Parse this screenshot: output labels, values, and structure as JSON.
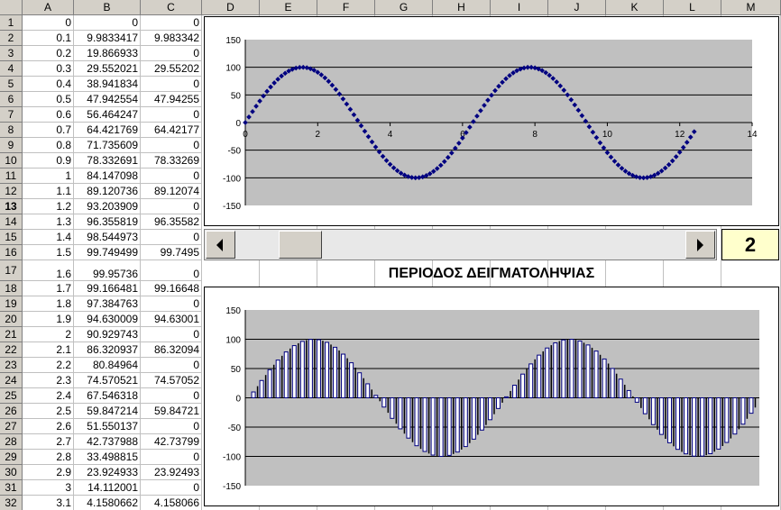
{
  "columns": [
    "A",
    "B",
    "C",
    "D",
    "E",
    "F",
    "G",
    "H",
    "I",
    "J",
    "K",
    "L",
    "M"
  ],
  "rows": [
    {
      "n": "1",
      "a": "0",
      "b": "0",
      "c": "0"
    },
    {
      "n": "2",
      "a": "0.1",
      "b": "9.9833417",
      "c": "9.983342"
    },
    {
      "n": "3",
      "a": "0.2",
      "b": "19.866933",
      "c": "0"
    },
    {
      "n": "4",
      "a": "0.3",
      "b": "29.552021",
      "c": "29.55202"
    },
    {
      "n": "5",
      "a": "0.4",
      "b": "38.941834",
      "c": "0"
    },
    {
      "n": "6",
      "a": "0.5",
      "b": "47.942554",
      "c": "47.94255"
    },
    {
      "n": "7",
      "a": "0.6",
      "b": "56.464247",
      "c": "0"
    },
    {
      "n": "8",
      "a": "0.7",
      "b": "64.421769",
      "c": "64.42177"
    },
    {
      "n": "9",
      "a": "0.8",
      "b": "71.735609",
      "c": "0"
    },
    {
      "n": "10",
      "a": "0.9",
      "b": "78.332691",
      "c": "78.33269"
    },
    {
      "n": "11",
      "a": "1",
      "b": "84.147098",
      "c": "0"
    },
    {
      "n": "12",
      "a": "1.1",
      "b": "89.120736",
      "c": "89.12074"
    },
    {
      "n": "13",
      "a": "1.2",
      "b": "93.203909",
      "c": "0"
    },
    {
      "n": "14",
      "a": "1.3",
      "b": "96.355819",
      "c": "96.35582"
    },
    {
      "n": "15",
      "a": "1.4",
      "b": "98.544973",
      "c": "0"
    },
    {
      "n": "16",
      "a": "1.5",
      "b": "99.749499",
      "c": "99.7495"
    },
    {
      "n": "17",
      "a": "1.6",
      "b": "99.95736",
      "c": "0"
    },
    {
      "n": "18",
      "a": "1.7",
      "b": "99.166481",
      "c": "99.16648"
    },
    {
      "n": "19",
      "a": "1.8",
      "b": "97.384763",
      "c": "0"
    },
    {
      "n": "20",
      "a": "1.9",
      "b": "94.630009",
      "c": "94.63001"
    },
    {
      "n": "21",
      "a": "2",
      "b": "90.929743",
      "c": "0"
    },
    {
      "n": "22",
      "a": "2.1",
      "b": "86.320937",
      "c": "86.32094"
    },
    {
      "n": "23",
      "a": "2.2",
      "b": "80.84964",
      "c": "0"
    },
    {
      "n": "24",
      "a": "2.3",
      "b": "74.570521",
      "c": "74.57052"
    },
    {
      "n": "25",
      "a": "2.4",
      "b": "67.546318",
      "c": "0"
    },
    {
      "n": "26",
      "a": "2.5",
      "b": "59.847214",
      "c": "59.84721"
    },
    {
      "n": "27",
      "a": "2.6",
      "b": "51.550137",
      "c": "0"
    },
    {
      "n": "28",
      "a": "2.7",
      "b": "42.737988",
      "c": "42.73799"
    },
    {
      "n": "29",
      "a": "2.8",
      "b": "33.498815",
      "c": "0"
    },
    {
      "n": "30",
      "a": "2.9",
      "b": "23.924933",
      "c": "23.92493"
    },
    {
      "n": "31",
      "a": "3",
      "b": "14.112001",
      "c": "0"
    },
    {
      "n": "32",
      "a": "3.1",
      "b": "4.1580662",
      "c": "4.158066"
    }
  ],
  "selected_row": "13",
  "scroll_value": "2",
  "sampling_title": "ΠΕΡΙΟΔΟΣ ΔΕΙΓΜΑΤΟΛΗΨΙΑΣ",
  "colors": {
    "plot_bg": "#c0c0c0",
    "marker": "#000080",
    "bar_fill": "#000080",
    "header_bg": "#d4d0c8",
    "value_box": "#ffffcc"
  },
  "chart_data": [
    {
      "type": "scatter",
      "title": "",
      "xlabel": "",
      "ylabel": "",
      "xlim": [
        0,
        14
      ],
      "ylim": [
        -150,
        150
      ],
      "xticks": [
        "0",
        "2",
        "4",
        "6",
        "8",
        "10",
        "12",
        "14"
      ],
      "yticks": [
        "150",
        "100",
        "50",
        "0",
        "-50",
        "-100",
        "-150"
      ],
      "series": [
        {
          "function": "y = 100*sin(x)",
          "x_start": 0,
          "x_end": 12.4,
          "x_step": 0.1
        }
      ],
      "grid": "horizontal"
    },
    {
      "type": "bar",
      "title": "",
      "xlabel": "",
      "ylabel": "",
      "ylim": [
        -150,
        150
      ],
      "yticks": [
        "150",
        "100",
        "50",
        "0",
        "-50",
        "-100",
        "-150"
      ],
      "series": [
        {
          "function": "y = 100*sin(x)",
          "x_start": 0,
          "x_end": 12.4,
          "x_step": 0.1,
          "style": "line"
        },
        {
          "function": "y = 100*sin(x) at every 2nd sample, else 0",
          "sampling_period": 2,
          "style": "hollow bar"
        }
      ],
      "grid": "horizontal"
    }
  ]
}
